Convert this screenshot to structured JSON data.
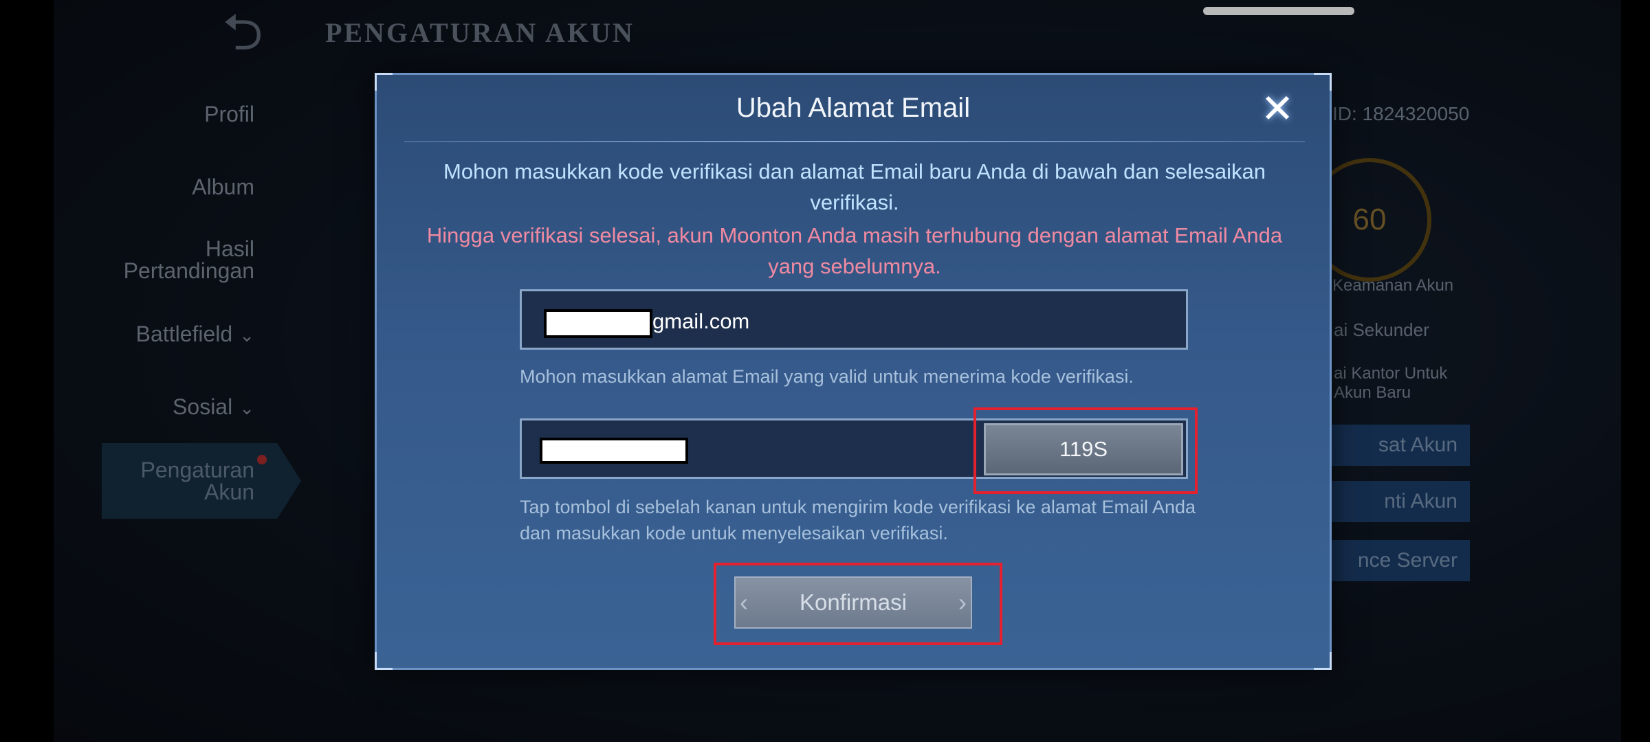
{
  "background": {
    "page_title": "PENGATURAN AKUN",
    "sidebar": [
      {
        "label": "Profil"
      },
      {
        "label": "Album"
      },
      {
        "label": "Hasil\nPertandingan"
      },
      {
        "label": "Battlefield"
      },
      {
        "label": "Sosial"
      },
      {
        "label": "Pengaturan\nAkun"
      }
    ],
    "account_id": "ID: 1824320050",
    "level": "60",
    "security_label": "Keamanan Akun",
    "secondary_label": "ai Sekunder",
    "new_label": "ai Kantor Untuk\nAkun Baru",
    "buttons": [
      "sat Akun",
      "nti Akun",
      "nce Server"
    ]
  },
  "dialog": {
    "title": "Ubah Alamat Email",
    "instruction": "Mohon masukkan kode verifikasi dan alamat Email baru Anda di bawah dan selesaikan verifikasi.",
    "warning": "Hingga verifikasi selesai, akun Moonton Anda masih terhubung dengan alamat Email Anda yang sebelumnya.",
    "email_value_visible": "gmail.com",
    "email_hint": "Mohon masukkan alamat Email yang valid untuk menerima kode verifikasi.",
    "send_code_countdown": "119S",
    "code_hint": "Tap tombol di sebelah kanan untuk mengirim kode verifikasi ke alamat Email Anda dan masukkan kode untuk menyelesaikan verifikasi.",
    "confirm_label": "Konfirmasi"
  }
}
